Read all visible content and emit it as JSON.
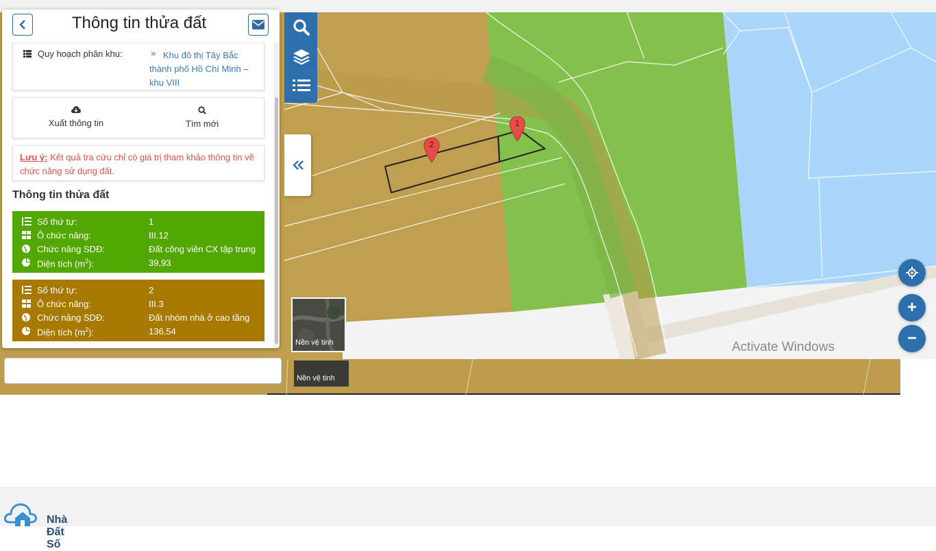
{
  "panel": {
    "title": "Thông tin thửa đất",
    "zoning": {
      "label": "Quy hoạch phân khu:",
      "value": "Khu đô thị Tây Bắc thành phố Hồ Chí Minh – khu VIII"
    },
    "actions": {
      "export_label": "Xuất thông tin",
      "new_search_label": "Tìm mới"
    },
    "note": {
      "prefix": "Lưu ý:",
      "text": " Kết quả tra cứu chỉ có giá trị tham khảo thông tin về chức năng sử dụng đất."
    },
    "section_title": "Thông tin thửa đất",
    "field_labels": {
      "order": "Số thứ tự:",
      "cell": "Ô chức năng:",
      "function": "Chức năng SDĐ:",
      "area": "Diện tích (m",
      "area_sup": "2",
      "area_end": "):"
    },
    "parcels": [
      {
        "order": "1",
        "cell": "III.12",
        "function": "Đất công viên CX tập trung",
        "area": "39,93",
        "color": "#52a800"
      },
      {
        "order": "2",
        "cell": "III.3",
        "function": "Đất nhóm nhà ở cao tầng",
        "area": "136,54",
        "color": "#a87900"
      }
    ]
  },
  "map": {
    "markers": [
      "1",
      "2"
    ],
    "satellite_label": "Nền vệ tinh",
    "colors": {
      "park": "#84c04c",
      "residential": "#c0a050",
      "water": "#a9d6fa",
      "road": "#f2f2f2",
      "accent": "#2d6fad"
    }
  },
  "controls": {
    "toolbar": [
      "search-icon",
      "layers-icon",
      "list-icon"
    ],
    "locate": "crosshair-icon",
    "zoom_in": "+",
    "zoom_out": "−"
  },
  "watermark": "Activate Windows",
  "brand": {
    "name": "Nhà Đất Số"
  }
}
